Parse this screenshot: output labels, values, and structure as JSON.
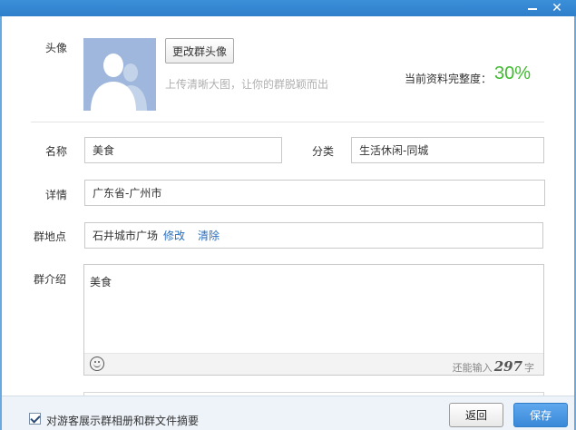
{
  "colors": {
    "titlebar": "#3b8fd9",
    "accent_green": "#3fba2f",
    "link_blue": "#2a6ebd",
    "save_button": "#3a88d8"
  },
  "window": {
    "minimize_icon": "minimize-icon",
    "close_icon": "close-icon",
    "close_glyph": "✕"
  },
  "avatar": {
    "label": "头像",
    "change_button": "更改群头像",
    "hint": "上传清晰大图，让你的群脱颖而出"
  },
  "completeness": {
    "label": "当前资料完整度：",
    "value": "30%",
    "percent": 30
  },
  "fields": {
    "name_label": "名称",
    "name_value": "美食",
    "category_label": "分类",
    "category_value": "生活休闲-同城",
    "detail_label": "详情",
    "detail_value": "广东省-广州市",
    "location_label": "群地点",
    "location_value": "石井城市广场",
    "location_edit": "修改",
    "location_clear": "清除"
  },
  "intro": {
    "label": "群介绍",
    "value": "美食",
    "counter_prefix": "还能输入",
    "counter_number": "297",
    "counter_suffix": "字",
    "emoji_icon": "smiley-icon"
  },
  "footer": {
    "checkbox_label": "对游客展示群相册和群文件摘要",
    "checkbox_checked": true,
    "back_button": "返回",
    "save_button": "保存"
  }
}
